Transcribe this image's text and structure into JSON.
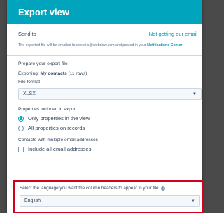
{
  "dialog": {
    "title": "Export view"
  },
  "send_to": {
    "label": "Send to",
    "link": "Not getting our email",
    "info_prefix": "The exported file will be emailed to deepti.s@webdew.com and posted in your ",
    "info_link": "Notifications Center"
  },
  "prepare": {
    "title": "Prepare your export file",
    "exporting_label": "Exporting:",
    "exporting_value": "My contacts",
    "exporting_rows": "(11 rows)"
  },
  "file_format": {
    "label": "File format",
    "selected": "XLSX"
  },
  "properties": {
    "label": "Properties included in export",
    "options": [
      {
        "label": "Only properties in the view",
        "checked": true
      },
      {
        "label": "All properties on records",
        "checked": false
      }
    ]
  },
  "contacts": {
    "label": "Contacts with multiple email addresses",
    "checkbox_label": "Include all email addresses"
  },
  "language": {
    "label": "Select the language you want the column headers to appear in your file",
    "selected": "English"
  },
  "colors": {
    "header": "#00a4bd",
    "highlight": "#d0021b"
  }
}
